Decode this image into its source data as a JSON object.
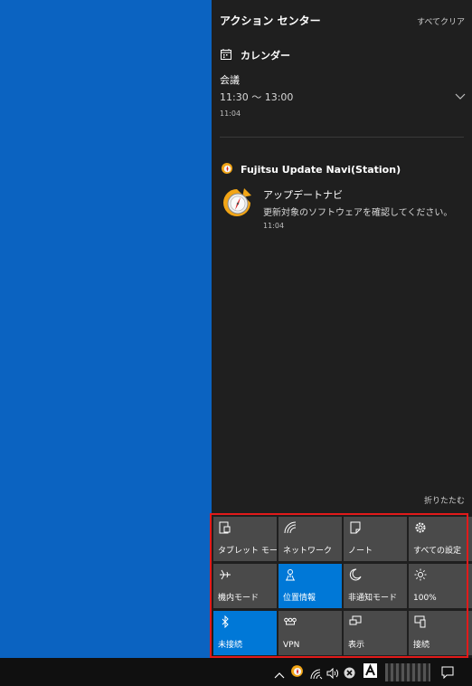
{
  "action_center": {
    "title": "アクション センター",
    "clear_all": "すべてクリア",
    "collapse": "折りたたむ"
  },
  "calendar": {
    "app_name": "カレンダー",
    "event_title": "会議",
    "event_time": "11:30 〜 13:00",
    "timestamp": "11:04"
  },
  "fujitsu": {
    "app_name": "Fujitsu Update Navi(Station)",
    "notif_title": "アップデートナビ",
    "notif_body": "更新対象のソフトウェアを確認してください。",
    "timestamp": "11:04"
  },
  "quick_actions": [
    {
      "label": "タブレット モード",
      "icon": "tablet-mode-icon",
      "active": false
    },
    {
      "label": "ネットワーク",
      "icon": "network-icon",
      "active": false
    },
    {
      "label": "ノート",
      "icon": "note-icon",
      "active": false
    },
    {
      "label": "すべての設定",
      "icon": "settings-gear-icon",
      "active": false
    },
    {
      "label": "機内モード",
      "icon": "airplane-icon",
      "active": false
    },
    {
      "label": "位置情報",
      "icon": "location-icon",
      "active": true
    },
    {
      "label": "非通知モード",
      "icon": "moon-icon",
      "active": false
    },
    {
      "label": "100%",
      "icon": "brightness-icon",
      "active": false
    },
    {
      "label": "未接続",
      "icon": "bluetooth-icon",
      "active": true
    },
    {
      "label": "VPN",
      "icon": "vpn-icon",
      "active": false
    },
    {
      "label": "表示",
      "icon": "display-icon",
      "active": false
    },
    {
      "label": "接続",
      "icon": "connect-icon",
      "active": false
    }
  ],
  "colors": {
    "accent": "#0078d7",
    "tile": "#4a4a4a",
    "panel": "#1f1f1f",
    "highlight_border": "#e11a1a",
    "desktop": "#0b63c1"
  }
}
